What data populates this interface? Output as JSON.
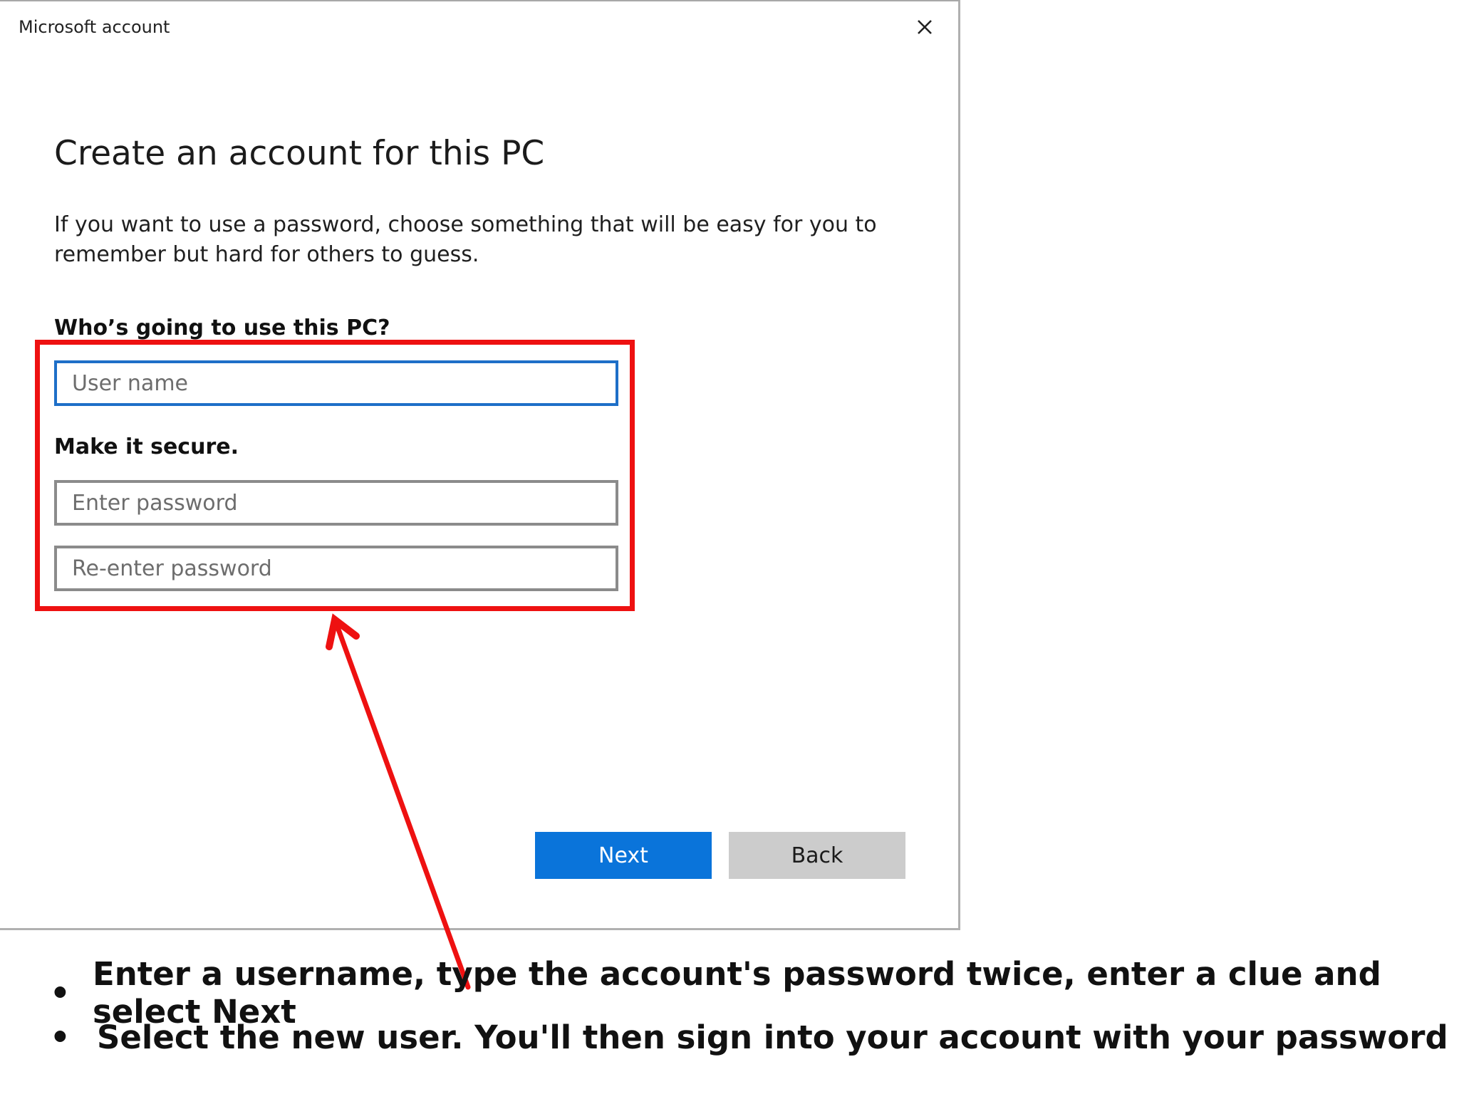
{
  "dialog": {
    "window_title": "Microsoft account",
    "close_icon": "close-icon",
    "heading": "Create an account for this PC",
    "description": "If you want to use a password, choose something that will be easy for you to remember but hard for others to guess.",
    "who_label": "Who’s going to use this PC?",
    "username": {
      "value": "",
      "placeholder": "User name"
    },
    "secure_label": "Make it secure.",
    "password": {
      "value": "",
      "placeholder": "Enter password"
    },
    "reenter_password": {
      "value": "",
      "placeholder": "Re-enter password"
    },
    "next_label": "Next",
    "back_label": "Back"
  },
  "annotation": {
    "highlight_color": "#ee1111",
    "bullets": [
      "Enter a username, type the account's password twice, enter a clue and select Next",
      "Select the new user. You'll then sign into your account with your password"
    ],
    "bullet_symbol": "•"
  },
  "colors": {
    "accent": "#0a74da",
    "focus_border": "#1e6fc8",
    "back_button": "#cccccc"
  }
}
